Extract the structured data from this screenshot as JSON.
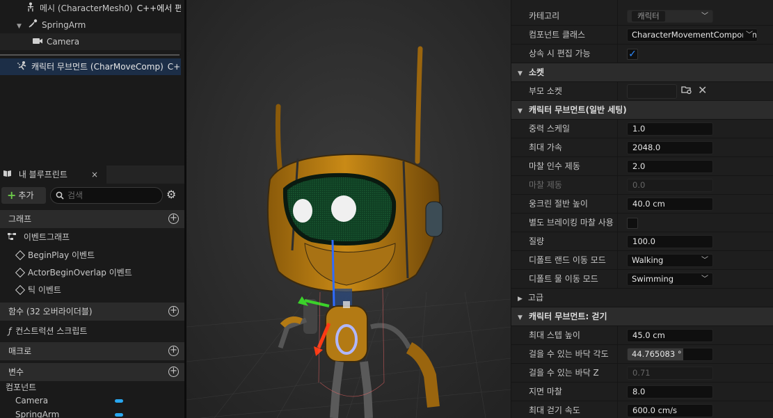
{
  "components_tree": {
    "items": [
      {
        "label": "메시 (CharacterMesh0)",
        "suffix": "C++에서 편",
        "icon": "skeleton-icon"
      },
      {
        "label": "SpringArm",
        "icon": "spring-arm-icon"
      },
      {
        "label": "Camera",
        "icon": "camera-icon"
      },
      {
        "label": "캐릭터 무브먼트 (CharMoveComp)",
        "suffix": "C+",
        "icon": "movement-component-icon"
      }
    ]
  },
  "my_blueprint": {
    "tab_label": "내 블루프린트",
    "close_glyph": "×",
    "add_label": "추가",
    "search_placeholder": "검색",
    "graphs_header": "그래프",
    "event_graph_label": "이벤트그래프",
    "events": [
      "BeginPlay 이벤트",
      "ActorBeginOverlap 이벤트",
      "틱 이벤트"
    ],
    "functions_header": "함수 (32 오버라이더블)",
    "construction_script_label": "컨스트럭션 스크립트",
    "macros_header": "매크로",
    "variables_header": "변수",
    "components_category": "컴포넌트",
    "component_vars": [
      "Camera",
      "SpringArm"
    ]
  },
  "details": {
    "category_label": "카테고리",
    "category_value": "캐릭터",
    "component_class_label": "컴포넌트 클래스",
    "component_class_value": "CharacterMovementComponent",
    "editable_when_inherited_label": "상속 시 편집 가능",
    "socket_header": "소켓",
    "parent_socket_label": "부모 소켓",
    "general_settings_header": "캐릭터 무브먼트(일반 세팅)",
    "general": [
      {
        "label": "중력 스케일",
        "value": "1.0"
      },
      {
        "label": "최대 가속",
        "value": "2048.0"
      },
      {
        "label": "마찰 인수 제동",
        "value": "2.0"
      },
      {
        "label": "마찰 제동",
        "value": "0.0"
      },
      {
        "label": "웅크린 절반 높이",
        "value": "40.0 cm"
      },
      {
        "label": "별도 브레이킹 마찰 사용"
      },
      {
        "label": "질량",
        "value": "100.0"
      }
    ],
    "default_land_mode_label": "디폴트 랜드 이동 모드",
    "default_land_mode_value": "Walking",
    "default_water_mode_label": "디폴트 물 이동 모드",
    "default_water_mode_value": "Swimming",
    "advanced_label": "고급",
    "walking_header": "캐릭터 무브먼트: 걷기",
    "walking": [
      {
        "label": "최대 스텝 높이",
        "value": "45.0 cm"
      },
      {
        "label": "걸을 수 있는 바닥 각도",
        "value": "44.765083 °"
      },
      {
        "label": "걸을 수 있는 바닥 Z",
        "value": "0.71"
      },
      {
        "label": "지면 마찰",
        "value": "8.0"
      },
      {
        "label": "최대 걷기 속도",
        "value": "600.0 cm/s"
      }
    ]
  },
  "colors": {
    "selection": "#1c2e47",
    "accent_blue": "#2e8bff",
    "add_green": "#6cc84a",
    "robot_orange": "#c98a16"
  }
}
